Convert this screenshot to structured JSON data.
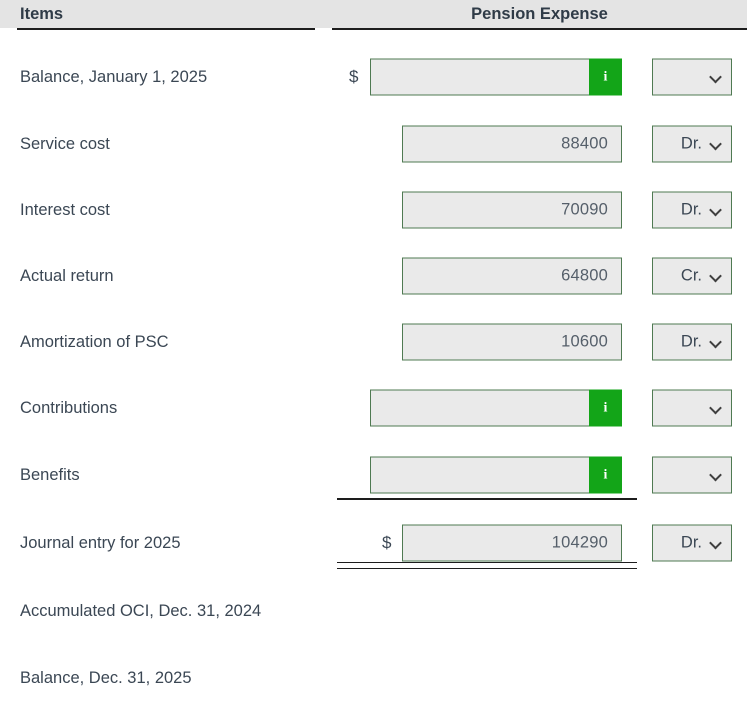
{
  "table": {
    "headers": {
      "items": "Items",
      "pension_expense": "Pension Expense"
    },
    "currency_symbol": "$",
    "info_icon_label": "i",
    "rows": [
      {
        "label": "Balance, January 1, 2025",
        "field_type": "info",
        "value": "",
        "dr_cr": ""
      },
      {
        "label": "Service cost",
        "field_type": "value",
        "value": "88400",
        "dr_cr": "Dr."
      },
      {
        "label": "Interest cost",
        "field_type": "value",
        "value": "70090",
        "dr_cr": "Dr."
      },
      {
        "label": "Actual return",
        "field_type": "value",
        "value": "64800",
        "dr_cr": "Cr."
      },
      {
        "label": "Amortization of PSC",
        "field_type": "value",
        "value": "10600",
        "dr_cr": "Dr."
      },
      {
        "label": "Contributions",
        "field_type": "info",
        "value": "",
        "dr_cr": ""
      },
      {
        "label": "Benefits",
        "field_type": "info",
        "value": "",
        "dr_cr": ""
      },
      {
        "label": "Journal entry for 2025",
        "field_type": "total",
        "value": "104290",
        "dr_cr": "Dr."
      },
      {
        "label": "Accumulated OCI, Dec. 31, 2024",
        "field_type": "none",
        "value": "",
        "dr_cr": ""
      },
      {
        "label": "Balance, Dec. 31, 2025",
        "field_type": "none",
        "value": "",
        "dr_cr": ""
      }
    ],
    "dropdown_options": [
      "",
      "Dr.",
      "Cr."
    ]
  },
  "colors": {
    "header_background": "#e4e4e4",
    "field_border": "#4f7a52",
    "field_background": "#eaeaea",
    "info_button": "#13a518",
    "text": "#3b4754"
  }
}
